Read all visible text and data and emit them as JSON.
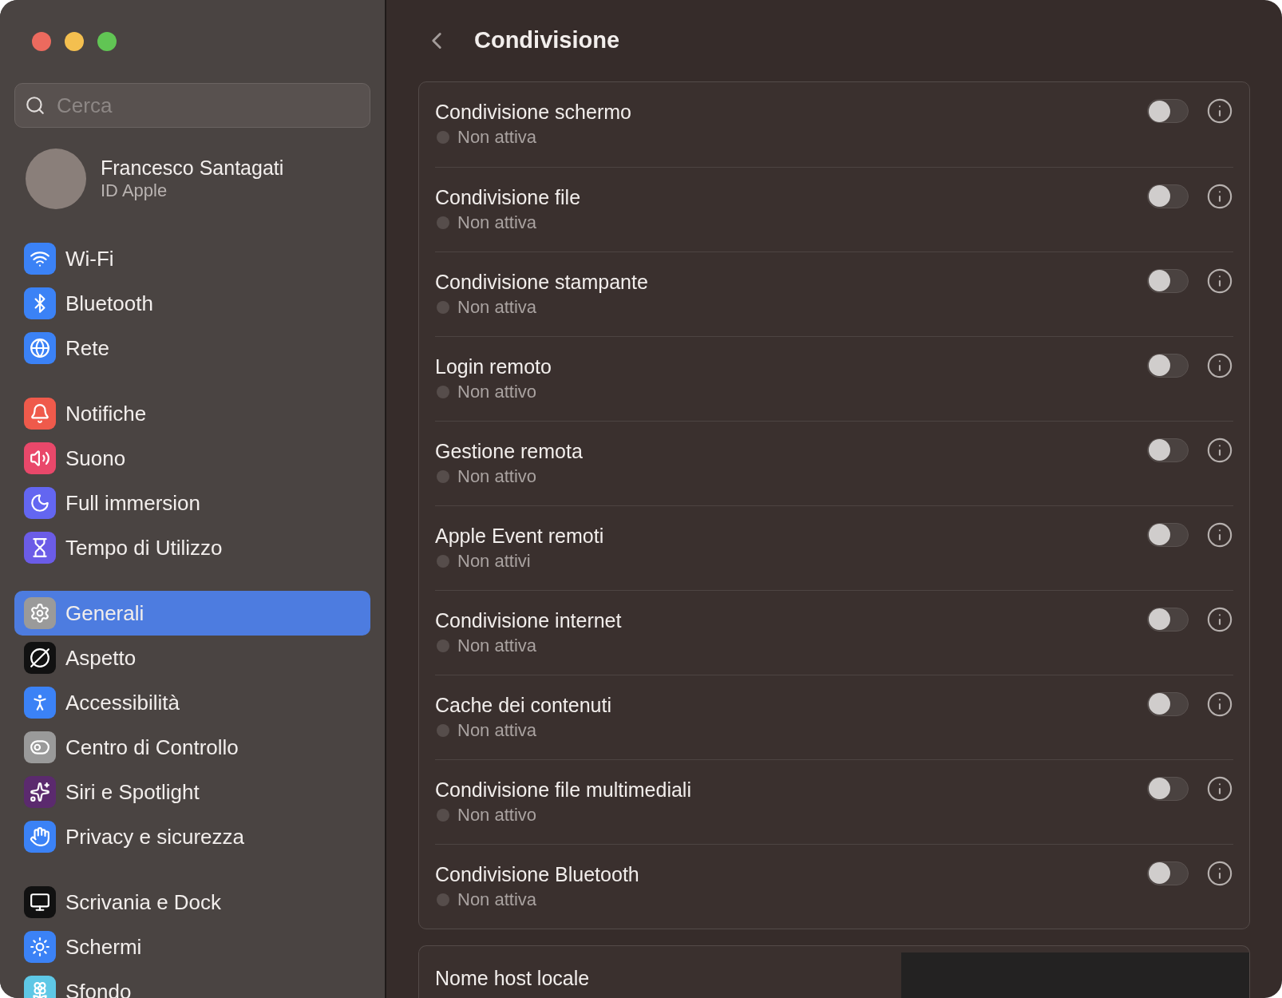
{
  "search": {
    "placeholder": "Cerca"
  },
  "profile": {
    "name": "Francesco Santagati",
    "subtitle": "ID Apple"
  },
  "sidebar": {
    "groups": [
      {
        "items": [
          {
            "label": "Wi-Fi",
            "selected": false
          },
          {
            "label": "Bluetooth",
            "selected": false
          },
          {
            "label": "Rete",
            "selected": false
          }
        ]
      },
      {
        "items": [
          {
            "label": "Notifiche",
            "selected": false
          },
          {
            "label": "Suono",
            "selected": false
          },
          {
            "label": "Full immersion",
            "selected": false
          },
          {
            "label": "Tempo di Utilizzo",
            "selected": false
          }
        ]
      },
      {
        "items": [
          {
            "label": "Generali",
            "selected": true
          },
          {
            "label": "Aspetto",
            "selected": false
          },
          {
            "label": "Accessibilità",
            "selected": false
          },
          {
            "label": "Centro di Controllo",
            "selected": false
          },
          {
            "label": "Siri e Spotlight",
            "selected": false
          },
          {
            "label": "Privacy e sicurezza",
            "selected": false
          }
        ]
      },
      {
        "items": [
          {
            "label": "Scrivania e Dock",
            "selected": false
          },
          {
            "label": "Schermi",
            "selected": false
          },
          {
            "label": "Sfondo",
            "selected": false
          }
        ]
      }
    ]
  },
  "title": "Condivisione",
  "services": [
    {
      "name": "Condivisione schermo",
      "status": "Non attiva",
      "on": false
    },
    {
      "name": "Condivisione file",
      "status": "Non attiva",
      "on": false
    },
    {
      "name": "Condivisione stampante",
      "status": "Non attiva",
      "on": false
    },
    {
      "name": "Login remoto",
      "status": "Non attivo",
      "on": false
    },
    {
      "name": "Gestione remota",
      "status": "Non attivo",
      "on": false
    },
    {
      "name": "Apple Event remoti",
      "status": "Non attivi",
      "on": false
    },
    {
      "name": "Condivisione internet",
      "status": "Non attiva",
      "on": false
    },
    {
      "name": "Cache dei contenuti",
      "status": "Non attiva",
      "on": false
    },
    {
      "name": "Condivisione file multimediali",
      "status": "Non attivo",
      "on": false
    },
    {
      "name": "Condivisione Bluetooth",
      "status": "Non attiva",
      "on": false
    }
  ],
  "hostname": {
    "label": "Nome host locale"
  }
}
